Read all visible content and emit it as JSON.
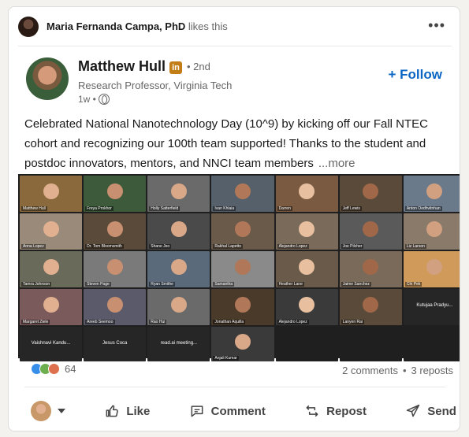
{
  "social_header": {
    "actor_name": "Maria Fernanda Campa, PhD",
    "action": "likes this",
    "menu_icon": "more-horizontal-icon"
  },
  "post": {
    "author": "Matthew Hull",
    "badge": "in",
    "degree": "• 2nd",
    "headline": "Research Professor, Virginia Tech",
    "time": "1w •",
    "follow_label": "+ Follow",
    "text": "Celebrated National Nanotechnology Day (10^9) by kicking off our Fall NTEC cohort and recognizing our 100th team supported! Thanks to the student and postdoc innovators, mentors, and NNCI team members",
    "more_label": "...more"
  },
  "video_tiles": [
    "Matthew Hull",
    "Freya Prokhor",
    "Holly Satterfield",
    "Ivan Khlaia",
    "Darren",
    "Jeff Lewis",
    "Anton Oedhvitnhan",
    "Anna Lopez",
    "Dr. Tom Bloomsmith",
    "Shane Jeo",
    "Rakhal Lapetto",
    "Alejandro Lopez",
    "Joe Pilcher",
    "Liz Larson",
    "Tamra Johnson",
    "Steven Page",
    "Ryan Smithe",
    "Samantha",
    "Heather Lane",
    "Jaime Sanchez",
    "Chi Pek",
    "Margaret Ziele",
    "Areeb Seemoo",
    "Rao Hui",
    "Jonathan Aquilla",
    "Alejandro Lopez",
    "Lanyen Rai",
    "Kutujaa Pradyumna",
    "Vaishnavi Kandu...",
    "Jesus Coca",
    "read.ai meeting...",
    "Anjali Kumar"
  ],
  "tile_captions": {
    "row4_last": "Kutujaa Pradyu...",
    "row5": [
      "Vaishnavi Kandu...",
      "Jesus Coca",
      "read.ai meeting..."
    ]
  },
  "social_counts": {
    "reaction_count": "64",
    "comments": "2 comments",
    "separator": "•",
    "reposts": "3 reposts"
  },
  "actions": {
    "like": "Like",
    "comment": "Comment",
    "repost": "Repost",
    "send": "Send"
  },
  "colors": {
    "accent": "#0a66c2",
    "linkedin_gold": "#c37d16"
  }
}
